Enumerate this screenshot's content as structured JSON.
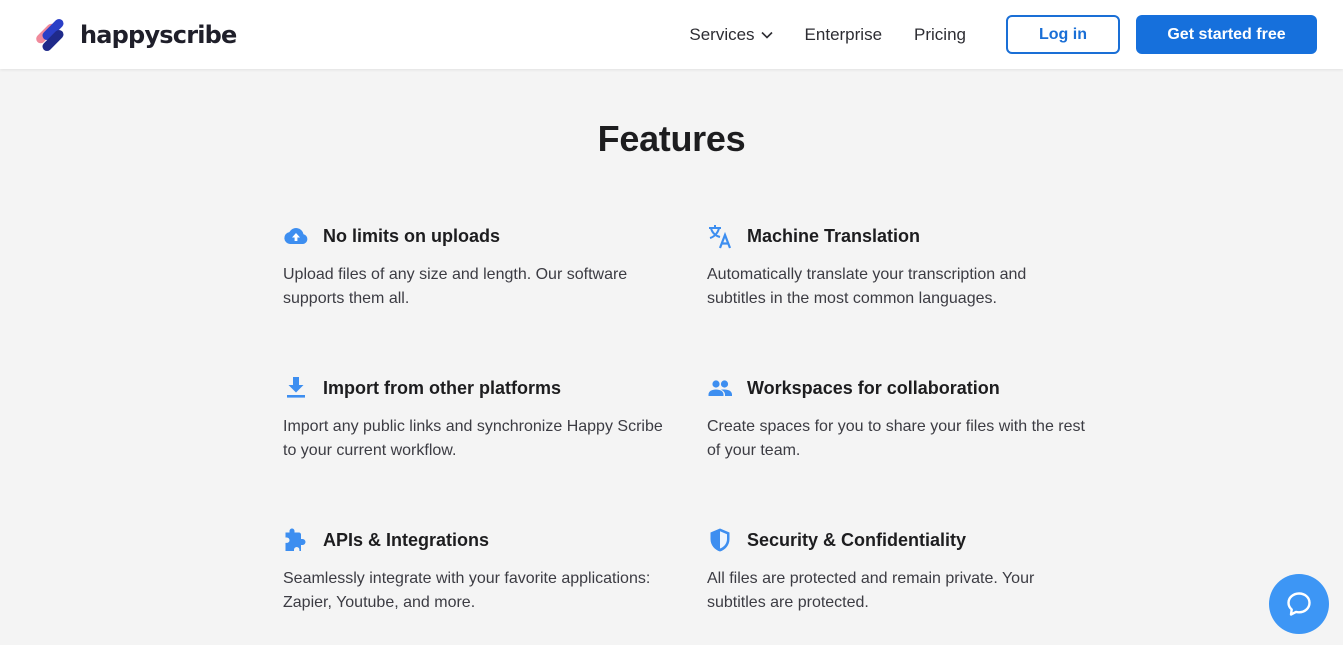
{
  "header": {
    "logo_text": "happyscribe",
    "nav": {
      "services": "Services",
      "enterprise": "Enterprise",
      "pricing": "Pricing"
    },
    "login_label": "Log in",
    "start_label": "Get started free"
  },
  "main": {
    "title": "Features",
    "features": [
      {
        "icon": "cloud-upload-icon",
        "title": "No limits on uploads",
        "desc": "Upload files of any size and length. Our software supports them all."
      },
      {
        "icon": "translate-icon",
        "title": "Machine Translation",
        "desc": "Automatically translate your transcription and subtitles in the most common languages."
      },
      {
        "icon": "download-icon",
        "title": "Import from other platforms",
        "desc": "Import any public links and synchronize Happy Scribe to your current workflow."
      },
      {
        "icon": "people-icon",
        "title": "Workspaces for collaboration",
        "desc": "Create spaces for you to share your files with the rest of your team."
      },
      {
        "icon": "puzzle-icon",
        "title": "APIs & Integrations",
        "desc": "Seamlessly integrate with your favorite applications: Zapier, Youtube, and more."
      },
      {
        "icon": "shield-icon",
        "title": "Security & Confidentiality",
        "desc": "All files are protected and remain private. Your subtitles are protected."
      }
    ]
  },
  "colors": {
    "accent": "#1670dc",
    "icon_blue": "#3d8ef0",
    "background": "#f4f4f4",
    "chat_bubble": "#3d96f5"
  }
}
